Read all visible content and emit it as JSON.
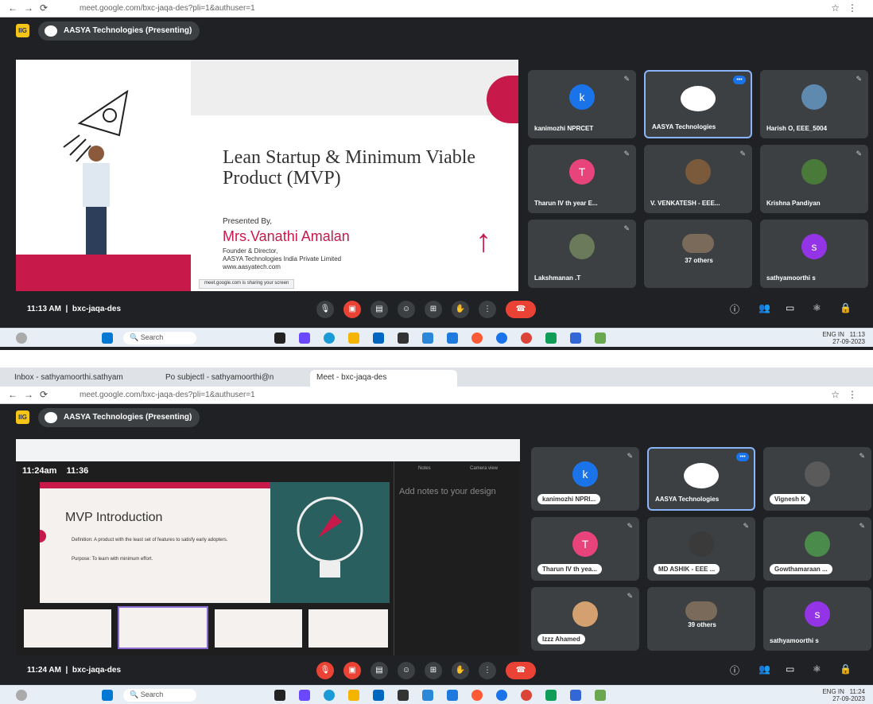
{
  "shot1": {
    "url": "meet.google.com/bxc-jaqa-des?pli=1&authuser=1",
    "meet_org": "AASYA Technologies (Presenting)",
    "logo": "IIG",
    "slide": {
      "title": "Lean Startup & Minimum Viable Product (MVP)",
      "presented_by": "Presented By,",
      "presenter": "Mrs.Vanathi Amalan",
      "role": "Founder & Director,",
      "company": "AASYA Technologies India Private Limited",
      "website": "www.aasyatech.com",
      "share_bar": "meet.google.com is sharing your screen"
    },
    "tiles": [
      {
        "initial": "k",
        "name": "kanimozhi NPRCET",
        "color": "#1a73e8"
      },
      {
        "initial": "",
        "name": "AASYA Technologies",
        "color": "#ffffff"
      },
      {
        "initial": "",
        "name": "Harish O, EEE_5004",
        "color": "#5f8ab0"
      },
      {
        "initial": "T",
        "name": "Tharun IV th year E...",
        "color": "#e8437b"
      },
      {
        "initial": "",
        "name": "V. VENKATESH - EEE...",
        "color": "#7a5a3a"
      },
      {
        "initial": "",
        "name": "Krishna Pandiyan",
        "color": "#4a7a3a"
      },
      {
        "initial": "",
        "name": "Lakshmanan .T",
        "color": "#6a7a5a"
      },
      {
        "initial": "",
        "name": "37 others",
        "color": "#7a6a5a"
      },
      {
        "initial": "s",
        "name": "sathyamoorthi s",
        "color": "#9334e6"
      }
    ],
    "time": "11:13 AM",
    "code": "bxc-jaqa-des",
    "taskbar_time": "11:13",
    "taskbar_date": "27-09-2023",
    "search": "Search",
    "lang": "ENG IN"
  },
  "shot2": {
    "tabs": [
      "Inbox - sathyamoorthi.sathyam",
      "Po subjectl - sathyamoorthi@n",
      "Meet - bxc-jaqa-des"
    ],
    "url": "meet.google.com/bxc-jaqa-des?pli=1&authuser=1",
    "meet_org": "AASYA Technologies (Presenting)",
    "logo": "IIG",
    "inner": {
      "clock": "11:24am",
      "timer": "11:36",
      "slide_title": "MVP Introduction",
      "bullet1": "Definition: A product with the least set of features to satisfy early adopters.",
      "bullet2": "Purpose: To learn with minimum effort.",
      "notes": "Add notes to your design",
      "notes_tab1": "Notes",
      "notes_tab2": "Camera view"
    },
    "tiles": [
      {
        "initial": "k",
        "name": "kanimozhi NPRI...",
        "color": "#1a73e8"
      },
      {
        "initial": "",
        "name": "AASYA Technologies",
        "color": "#ffffff"
      },
      {
        "initial": "",
        "name": "Vignesh K",
        "color": "#5a5a5a"
      },
      {
        "initial": "T",
        "name": "Tharun IV th yea...",
        "color": "#e8437b"
      },
      {
        "initial": "",
        "name": "MD ASHIK - EEE ...",
        "color": "#3a3a3a"
      },
      {
        "initial": "",
        "name": "Gowthamaraan ...",
        "color": "#4a8a4a"
      },
      {
        "initial": "",
        "name": "Izzz Ahamed",
        "color": "#d4a070"
      },
      {
        "initial": "",
        "name": "39 others",
        "color": "#7a6a5a"
      },
      {
        "initial": "s",
        "name": "sathyamoorthi s",
        "color": "#9334e6"
      }
    ],
    "time": "11:24 AM",
    "code": "bxc-jaqa-des",
    "taskbar_time": "11:24",
    "taskbar_date": "27-09-2023",
    "search": "Search",
    "lang": "ENG IN"
  }
}
